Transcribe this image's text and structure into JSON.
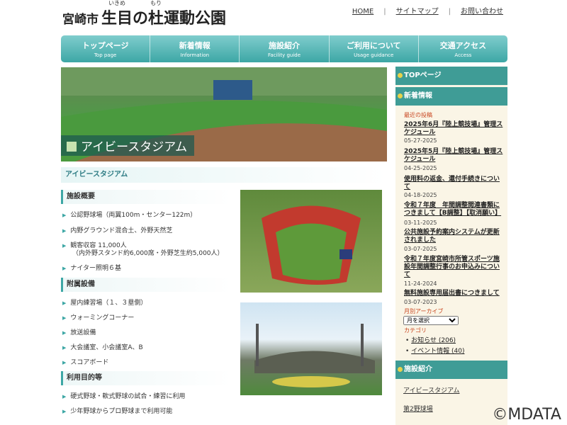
{
  "header": {
    "title_city": "宮崎市",
    "title_part1": "生目",
    "ruby1": "いきめ",
    "title_part2": "の",
    "title_part3": "杜",
    "ruby3": "もり",
    "title_part4": "運動公園",
    "top_links": [
      "HOME",
      "サイトマップ",
      "お問い合わせ"
    ]
  },
  "nav": [
    {
      "ja": "トップページ",
      "en": "Top page"
    },
    {
      "ja": "新着情報",
      "en": "Information"
    },
    {
      "ja": "施設紹介",
      "en": "Facility guide"
    },
    {
      "ja": "ご利用について",
      "en": "Usage guidance"
    },
    {
      "ja": "交通アクセス",
      "en": "Access"
    }
  ],
  "hero": {
    "caption": "アイビースタジアム"
  },
  "main": {
    "page_title": "アイビースタジアム",
    "sections": [
      {
        "heading": "施設概要",
        "items": [
          "公認野球場（両翼100m・センター122m）",
          "内野グラウンド混合土、外野天然芝",
          "観客収容 11,000人",
          "（内外野スタンド約6,000席・外野芝生約5,000人）",
          "ナイター照明６基"
        ]
      },
      {
        "heading": "附属設備",
        "items": [
          "屋内練習場（１、３塁側）",
          "ウォーミングコーナー",
          "放送設備",
          "大会議室、小会議室A、B",
          "スコアボード"
        ]
      },
      {
        "heading": "利用目的等",
        "items": [
          "硬式野球・軟式野球の試合・練習に利用",
          "少年野球からプロ野球まで利用可能"
        ]
      }
    ]
  },
  "sidebar": {
    "top_heading": "TOPページ",
    "news_heading": "新着情報",
    "news_label": "最近の投稿",
    "news": [
      {
        "title": "2025年6月『陸上競技場』管理スケジュール",
        "date": "05-27-2025"
      },
      {
        "title": "2025年5月『陸上競技場』管理スケジュール",
        "date": "04-25-2025"
      },
      {
        "title": "使用料の返金、還付手続きについて",
        "date": "04-18-2025"
      },
      {
        "title": "令和７年度　年間調整閲連書類につきまして【B調整】【取消願い】",
        "date": "03-11-2025"
      },
      {
        "title": "公共施設予約案内システムが更新されました",
        "date": "03-07-2025"
      },
      {
        "title": "令和７年度宮崎市所管スポーツ施設年間調整行事のお申込みについて",
        "date": "11-24-2024"
      },
      {
        "title": "無料施設専用届出書につきまして",
        "date": "03-07-2023"
      }
    ],
    "archive_label": "月別アーカイブ",
    "archive_select": "月を選択",
    "category_label": "カテゴリ",
    "categories": [
      "お知らせ (206)",
      "イベント情報 (40)"
    ],
    "facility_heading": "施設紹介",
    "facility_links": [
      "アイビースタジアム",
      "第2野球場"
    ]
  },
  "footer": {
    "copyright": "©MDATA"
  }
}
